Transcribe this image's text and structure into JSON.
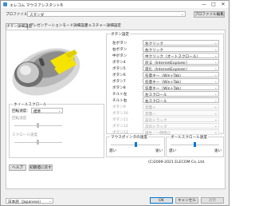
{
  "window": {
    "title": "エレコム マウスアシスタント6",
    "minimize": "—",
    "maximize": "□",
    "close": "✕"
  },
  "profile": {
    "label": "プロファイル：",
    "value": "スタンダ",
    "edit_button": "プロファイル編集"
  },
  "tabs": [
    "ボタン詳細設定",
    "プレゼンテーションモード詳細設定",
    "ジェスチャー詳細設定"
  ],
  "wheel_group": {
    "title": "ホイールスクロール",
    "speed_label": "回転速度：",
    "speed_value": "標準",
    "slider1_label": "回転速度",
    "slider2_label": "スクロール速度"
  },
  "button_settings": {
    "title": "ボタン設定",
    "rows": [
      {
        "name": "左ボタン",
        "value": "左クリック",
        "enabled": true
      },
      {
        "name": "右ボタン",
        "value": "右クリック",
        "enabled": true
      },
      {
        "name": "中ボタン",
        "value": "中クリック（オートスクロール）",
        "enabled": true
      },
      {
        "name": "ボタン4",
        "value": "戻る（InternetExplorer）",
        "enabled": true
      },
      {
        "name": "ボタン5",
        "value": "進む（InternetExplorer）",
        "enabled": true
      },
      {
        "name": "ボタン6",
        "value": "任意キー（Win+Tab）",
        "enabled": true
      },
      {
        "name": "ボタン7",
        "value": "任意キー（Win+Tab）",
        "enabled": true
      },
      {
        "name": "ボタン8",
        "value": "任意キー（Win+Tab）",
        "enabled": true
      },
      {
        "name": "チルト左",
        "value": "左スクロール",
        "enabled": true
      },
      {
        "name": "チルト右",
        "value": "右スクロール",
        "enabled": true
      },
      {
        "name": "ボタン9",
        "value": "音量＋",
        "enabled": false
      },
      {
        "name": "ボタン10",
        "value": "音量ー",
        "enabled": false
      },
      {
        "name": "ボタン11",
        "value": "前のトラック",
        "enabled": false
      },
      {
        "name": "ボタン12",
        "value": "次のトラック",
        "enabled": false
      },
      {
        "name": "ボタン13",
        "value": "再生／一時停止",
        "enabled": false
      }
    ]
  },
  "pointer_speed": {
    "title": "マウスポインタの速度",
    "slow": "遅い",
    "fast": "速い",
    "level": 0.5
  },
  "ball_speed": {
    "title": "ボールスクロール速度",
    "slow": "遅い",
    "fast": "速い",
    "level": 0.5
  },
  "copyright": "(C)2009-2021 ELECOM Co.,Ltd.",
  "footer": {
    "help_button": "ヘルプ",
    "reset_button": "初期値に戻す",
    "ok_button": "OK",
    "cancel_button": "キャンセル",
    "apply_button": "適用",
    "language": "日本語（Japanese）"
  },
  "colors": {
    "accent": "#0078d7",
    "highlight": "#f5e400"
  },
  "icons": {
    "combo_arrow": "chevron-down-icon"
  }
}
